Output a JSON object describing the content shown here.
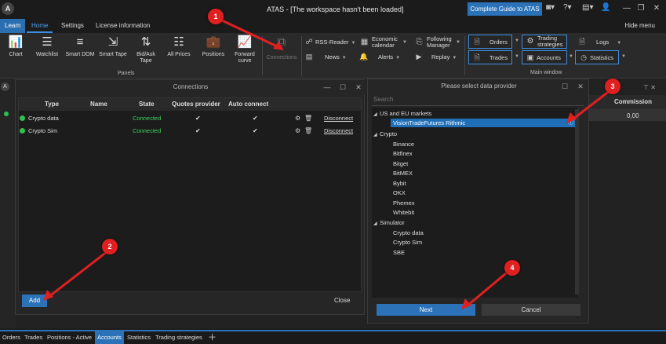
{
  "titlebar": {
    "app_logo": "A",
    "title": "ATAS - [The workspace hasn't been loaded]",
    "guide_button": "Complete Guide to ATAS",
    "icons": [
      "camera-icon",
      "help-icon",
      "flag-icon",
      "account-icon"
    ],
    "window_buttons": [
      "minimize",
      "maximize",
      "close"
    ]
  },
  "menu": {
    "learn": "Learn",
    "home": "Home",
    "settings": "Settings",
    "license": "License information",
    "hide_menu": "Hide menu"
  },
  "ribbon": {
    "chart": "Chart",
    "watchlist": "Watchlist",
    "smart_dom": "Smart DOM",
    "smart_tape": "Smart Tape",
    "bid_ask_tape": "Bid/Ask Tape",
    "all_prices": "All Prices",
    "positions": "Positions",
    "forward_curve": "Forward curve",
    "connections": "Connections",
    "panels_label": "Panels",
    "rss_reader": "RSS-Reader",
    "news": "News",
    "economic_calendar": "Economic calendar",
    "alerts": "Alerts",
    "following_manager": "Following Manager",
    "replay": "Replay",
    "orders": "Orders",
    "trades": "Trades",
    "trading_strategies": "Trading strategies",
    "accounts": "Accounts",
    "logs": "Logs",
    "statistics": "Statistics",
    "main_window_label": "Main window"
  },
  "background_panel": {
    "commission_header": "Commission",
    "commission_value": "0,00"
  },
  "connections_dialog": {
    "title": "Connections",
    "columns": [
      "Type",
      "Name",
      "State",
      "Quotes provider",
      "Auto connect"
    ],
    "rows": [
      {
        "type": "Crypto data",
        "name": "",
        "state": "Connected",
        "quotes_provider": "✔",
        "auto_connect": "✔",
        "action": "Disconnect"
      },
      {
        "type": "Crypto Sim",
        "name": "",
        "state": "Connected",
        "quotes_provider": "✔",
        "auto_connect": "✔",
        "action": "Disconnect"
      }
    ],
    "add_button": "Add",
    "close_button": "Close"
  },
  "provider_dialog": {
    "title": "Please select data provider",
    "search_placeholder": "Search",
    "groups": {
      "us_eu": {
        "label": "US and EU markets",
        "items": [
          "VisionTradeFutures Rithmic"
        ]
      },
      "crypto": {
        "label": "Crypto",
        "items": [
          "Binance",
          "Bitfinex",
          "Bitget",
          "BitMEX",
          "Bybit",
          "OKX",
          "Phemex",
          "Whitebit"
        ]
      },
      "simulator": {
        "label": "Simulator",
        "items": [
          "Crypto data",
          "Crypto Sim",
          "SBE"
        ]
      }
    },
    "selected_item": "VisionTradeFutures Rithmic",
    "next_button": "Next",
    "cancel_button": "Cancel"
  },
  "bottom_tabs": [
    "Orders",
    "Trades",
    "Positions - Active",
    "Accounts",
    "Statistics",
    "Trading strategies"
  ],
  "active_bottom_tab": "Accounts",
  "callouts": [
    "1",
    "2",
    "3",
    "4"
  ],
  "colors": {
    "accent": "#2b72b8",
    "connected": "#3fd15a",
    "callout": "#e02020"
  }
}
